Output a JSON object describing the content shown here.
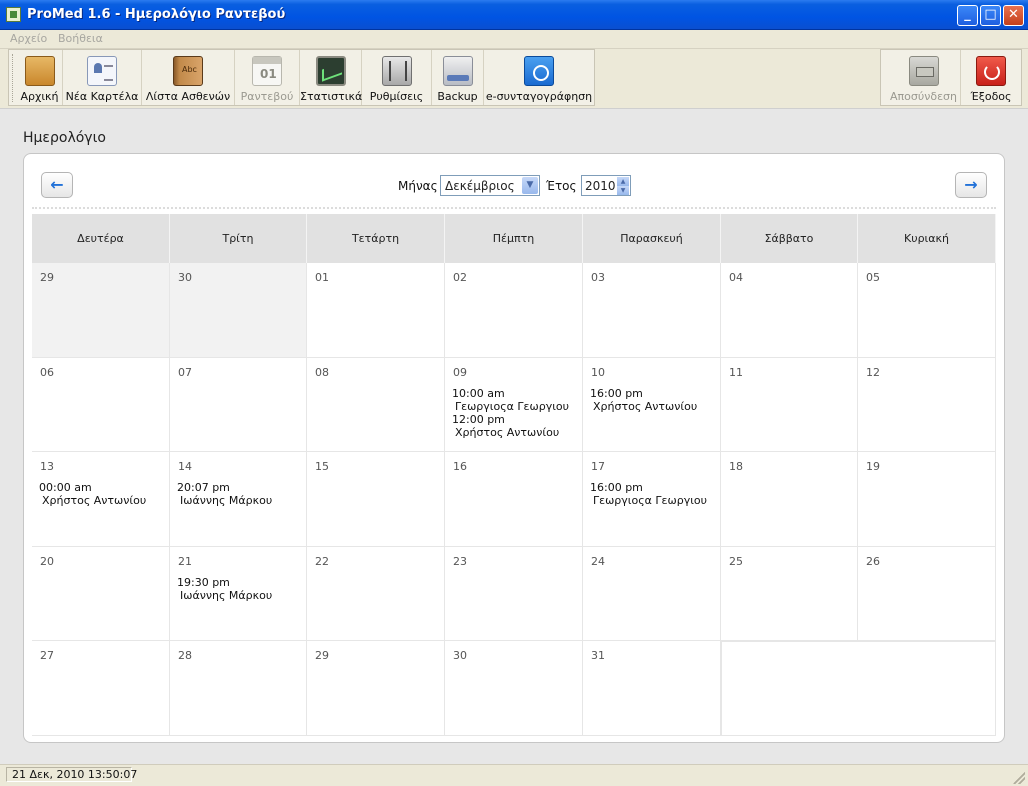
{
  "window": {
    "title": "ProMed 1.6 - Ημερολόγιο Ραντεβού",
    "minimize": "_",
    "maximize": "□",
    "close": "✕"
  },
  "menu": [
    "Αρχείο",
    "Βοήθεια"
  ],
  "toolbar": [
    {
      "label": "Αρχική",
      "icon": "home-icon",
      "disabled": false
    },
    {
      "label": "Νέα Καρτέλα",
      "icon": "patient-card-icon",
      "disabled": false
    },
    {
      "label": "Λίστα Ασθενών",
      "icon": "address-book-icon",
      "disabled": false
    },
    {
      "label": "Ραντεβού",
      "icon": "calendar-icon",
      "disabled": true
    },
    {
      "label": "Στατιστικά",
      "icon": "chart-icon",
      "disabled": false
    },
    {
      "label": "Ρυθμίσεις",
      "icon": "sliders-icon",
      "disabled": false
    },
    {
      "label": "Backup",
      "icon": "backup-drive-icon",
      "disabled": false
    },
    {
      "label": "e-συνταγογράφηση",
      "icon": "e-prescription-icon",
      "disabled": false
    }
  ],
  "toolbar_right": [
    {
      "label": "Αποσύνδεση",
      "icon": "logout-icon",
      "disabled": true
    },
    {
      "label": "Έξοδος",
      "icon": "power-icon",
      "disabled": false
    }
  ],
  "page": {
    "heading": "Ημερολόγιο"
  },
  "nav": {
    "prev": "←",
    "next": "→",
    "month_label": "Μήνας",
    "month_value": "Δεκέμβριος",
    "year_label": "Έτος",
    "year_value": "2010",
    "select_arrow": "▼",
    "spin_up": "▲",
    "spin_down": "▼"
  },
  "weekdays": [
    "Δευτέρα",
    "Τρίτη",
    "Τετάρτη",
    "Πέμπτη",
    "Παρασκευή",
    "Σάββατο",
    "Κυριακή"
  ],
  "weeks": [
    [
      {
        "day": "29",
        "other": true,
        "appts": []
      },
      {
        "day": "30",
        "other": true,
        "appts": []
      },
      {
        "day": "01",
        "appts": []
      },
      {
        "day": "02",
        "appts": []
      },
      {
        "day": "03",
        "appts": []
      },
      {
        "day": "04",
        "appts": []
      },
      {
        "day": "05",
        "appts": []
      }
    ],
    [
      {
        "day": "06",
        "appts": []
      },
      {
        "day": "07",
        "appts": []
      },
      {
        "day": "08",
        "appts": []
      },
      {
        "day": "09",
        "appts": [
          {
            "time": "10:00 am",
            "name": "Γεωργιοςα Γεωργιου"
          },
          {
            "time": "12:00 pm",
            "name": "Χρήστος Αντωνίου"
          }
        ]
      },
      {
        "day": "10",
        "appts": [
          {
            "time": "16:00 pm",
            "name": "Χρήστος Αντωνίου"
          }
        ]
      },
      {
        "day": "11",
        "appts": []
      },
      {
        "day": "12",
        "appts": []
      }
    ],
    [
      {
        "day": "13",
        "appts": [
          {
            "time": "00:00 am",
            "name": "Χρήστος Αντωνίου"
          }
        ]
      },
      {
        "day": "14",
        "appts": [
          {
            "time": "20:07 pm",
            "name": "Ιωάννης Μάρκου"
          }
        ]
      },
      {
        "day": "15",
        "appts": []
      },
      {
        "day": "16",
        "appts": []
      },
      {
        "day": "17",
        "appts": [
          {
            "time": "16:00 pm",
            "name": "Γεωργιοςα Γεωργιου"
          }
        ]
      },
      {
        "day": "18",
        "appts": []
      },
      {
        "day": "19",
        "appts": []
      }
    ],
    [
      {
        "day": "20",
        "appts": []
      },
      {
        "day": "21",
        "appts": [
          {
            "time": "19:30 pm",
            "name": "Ιωάννης Μάρκου"
          }
        ]
      },
      {
        "day": "22",
        "appts": []
      },
      {
        "day": "23",
        "appts": []
      },
      {
        "day": "24",
        "appts": []
      },
      {
        "day": "25",
        "appts": []
      },
      {
        "day": "26",
        "appts": []
      }
    ],
    [
      {
        "day": "27",
        "appts": []
      },
      {
        "day": "28",
        "appts": []
      },
      {
        "day": "29",
        "appts": []
      },
      {
        "day": "30",
        "appts": []
      },
      {
        "day": "31",
        "appts": []
      }
    ]
  ],
  "status": {
    "datetime": "21 Δεκ, 2010 13:50:07"
  }
}
